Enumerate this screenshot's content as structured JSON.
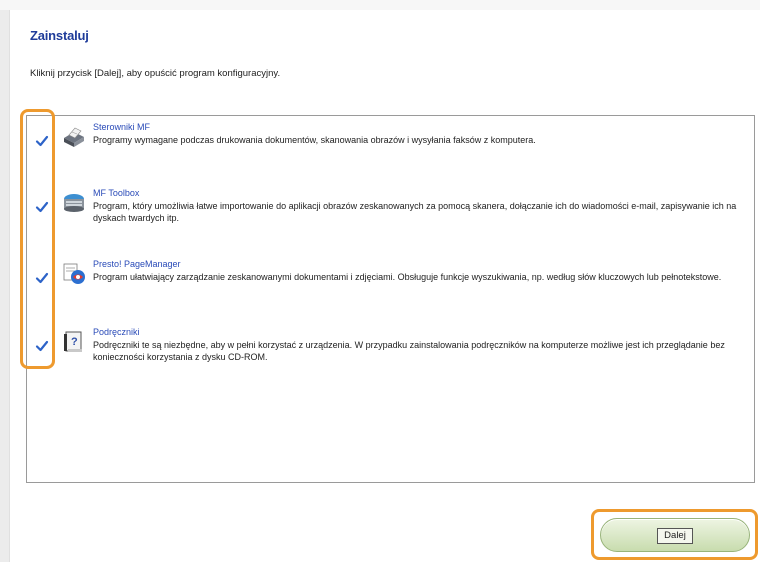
{
  "title": "Zainstaluj",
  "instruction": "Kliknij przycisk [Dalej], aby opuścić program konfiguracyjny.",
  "accent_color": "#ee9a2e",
  "link_color": "#2a4bb8",
  "items": [
    {
      "name": "Sterowniki MF",
      "description": "Programy wymagane podczas drukowania dokumentów, skanowania obrazów i wysyłania faksów z komputera.",
      "icon": "printer-icon",
      "checked": true
    },
    {
      "name": "MF Toolbox",
      "description": "Program, który umożliwia łatwe importowanie do aplikacji obrazów zeskanowanych za pomocą skanera, dołączanie ich do wiadomości e-mail, zapisywanie ich na dyskach twardych itp.",
      "icon": "scanner-icon",
      "checked": true
    },
    {
      "name": "Presto! PageManager",
      "description": "Program ułatwiający zarządzanie zeskanowanymi dokumentami i zdjęciami. Obsługuje funkcje wyszukiwania, np. według słów kluczowych lub pełnotekstowe.",
      "icon": "page-manager-icon",
      "checked": true
    },
    {
      "name": "Podręczniki",
      "description": "Podręczniki te są niezbędne, aby w pełni korzystać z urządzenia. W przypadku zainstalowania podręczników na komputerze możliwe jest ich przeglądanie bez konieczności korzystania z dysku CD-ROM.",
      "icon": "manual-book-icon",
      "checked": true
    }
  ],
  "next_button_label": "Dalej"
}
